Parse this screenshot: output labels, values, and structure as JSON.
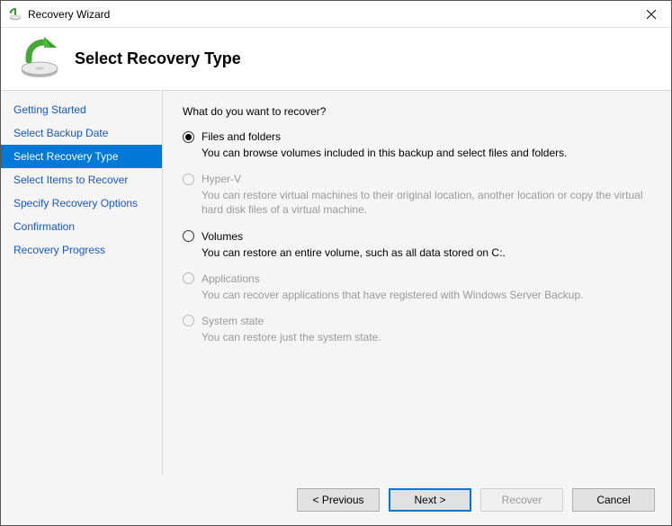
{
  "window": {
    "title": "Recovery Wizard"
  },
  "header": {
    "title": "Select Recovery Type"
  },
  "sidebar": {
    "steps": [
      {
        "label": "Getting Started",
        "active": false
      },
      {
        "label": "Select Backup Date",
        "active": false
      },
      {
        "label": "Select Recovery Type",
        "active": true
      },
      {
        "label": "Select Items to Recover",
        "active": false
      },
      {
        "label": "Specify Recovery Options",
        "active": false
      },
      {
        "label": "Confirmation",
        "active": false
      },
      {
        "label": "Recovery Progress",
        "active": false
      }
    ]
  },
  "content": {
    "prompt": "What do you want to recover?",
    "options": [
      {
        "id": "files-and-folders",
        "label": "Files and folders",
        "desc": "You can browse volumes included in this backup and select files and folders.",
        "enabled": true,
        "selected": true
      },
      {
        "id": "hyper-v",
        "label": "Hyper-V",
        "desc": "You can restore virtual machines to their original location, another location or copy the virtual hard disk files of a virtual machine.",
        "enabled": false,
        "selected": false
      },
      {
        "id": "volumes",
        "label": "Volumes",
        "desc": "You can restore an entire volume, such as all data stored on C:.",
        "enabled": true,
        "selected": false
      },
      {
        "id": "applications",
        "label": "Applications",
        "desc": "You can recover applications that have registered with Windows Server Backup.",
        "enabled": false,
        "selected": false
      },
      {
        "id": "system-state",
        "label": "System state",
        "desc": "You can restore just the system state.",
        "enabled": false,
        "selected": false
      }
    ]
  },
  "footer": {
    "previous": "< Previous",
    "next": "Next >",
    "recover": "Recover",
    "cancel": "Cancel",
    "recover_enabled": false
  }
}
